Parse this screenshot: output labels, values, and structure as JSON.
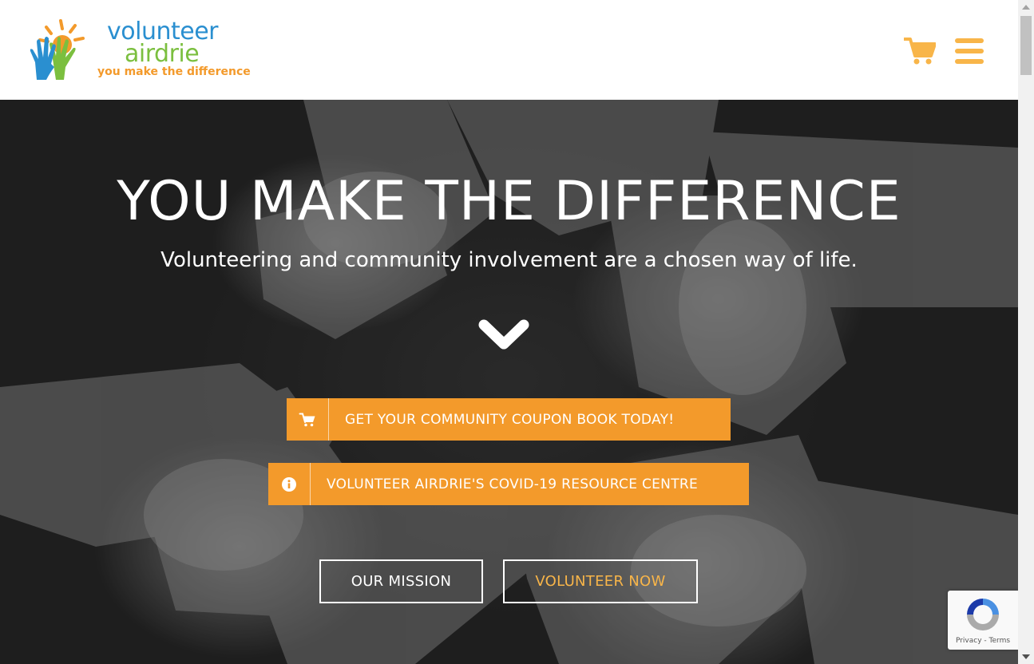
{
  "header": {
    "logo": {
      "line1": "volunteer",
      "line2": "airdrie",
      "tagline": "you make the difference"
    },
    "cart_icon": "shopping-cart-icon",
    "menu_icon": "hamburger-menu-icon"
  },
  "hero": {
    "title": "YOU MAKE THE DIFFERENCE",
    "subtitle": "Volunteering and community involvement are a chosen way of life.",
    "scroll_icon": "chevron-down-icon",
    "cta_buttons": [
      {
        "icon": "shopping-cart-icon",
        "label": "GET YOUR COMMUNITY COUPON BOOK TODAY!"
      },
      {
        "icon": "info-circle-icon",
        "label": "VOLUNTEER AIRDRIE'S COVID-19 RESOURCE CENTRE"
      }
    ],
    "outline_buttons": [
      {
        "label": "OUR MISSION"
      },
      {
        "label": "VOLUNTEER NOW"
      }
    ]
  },
  "recaptcha": {
    "privacy": "Privacy",
    "separator": " - ",
    "terms": "Terms"
  },
  "colors": {
    "accent_orange": "#f39a2b",
    "light_orange": "#f8b549",
    "logo_blue": "#2a8fd0",
    "logo_green": "#7bbf3f"
  }
}
